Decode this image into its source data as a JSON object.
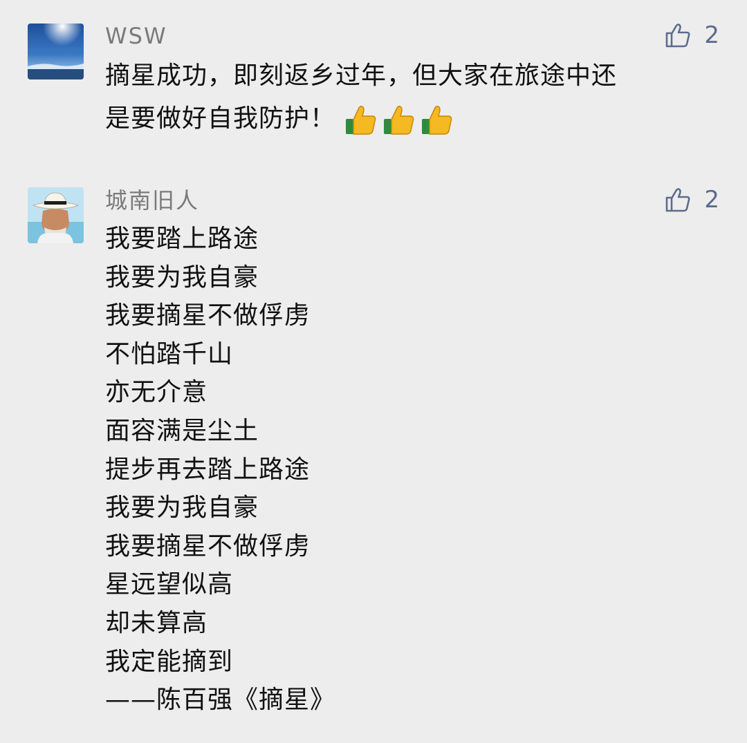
{
  "comments": [
    {
      "user": "WSW",
      "likes": "2",
      "lines": [
        "摘星成功，即刻返乡过年，但大家在旅途中还",
        "是要做好自我防护！"
      ],
      "emoji": [
        "thumbs-up-emoji",
        "thumbs-up-emoji",
        "thumbs-up-emoji"
      ],
      "avatar_icon": "sky-landscape-avatar"
    },
    {
      "user": "城南旧人",
      "likes": "2",
      "lines": [
        "我要踏上路途",
        "我要为我自豪",
        "我要摘星不做俘虏",
        "不怕踏千山",
        "亦无介意",
        "面容满是尘土",
        "提步再去踏上路途",
        "我要为我自豪",
        "我要摘星不做俘虏",
        "星远望似高",
        "却未算高",
        "我定能摘到",
        "——陈百强《摘星》"
      ],
      "avatar_icon": "man-in-hat-avatar"
    }
  ],
  "icons": {
    "like": "thumbs-up-outline-icon"
  },
  "colors": {
    "background": "#ededed",
    "username": "#7a7a7a",
    "like_accent": "#5b6b8f",
    "text": "#111111"
  }
}
